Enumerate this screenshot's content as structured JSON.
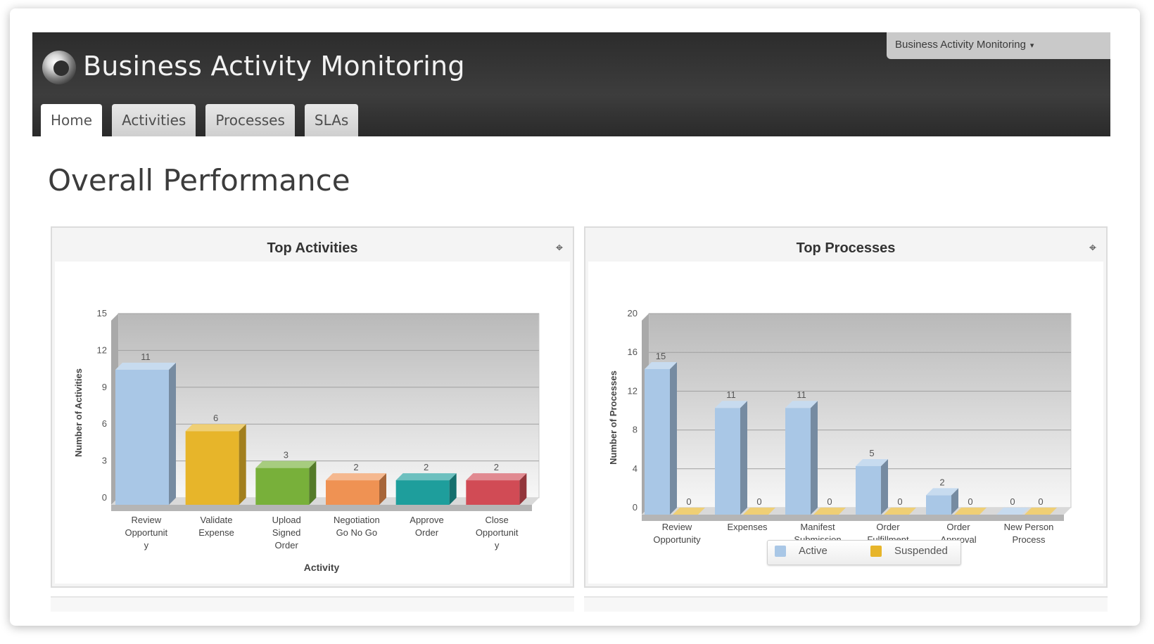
{
  "app": {
    "title": "Business Activity Monitoring",
    "menu_label": "Business Activity Monitoring",
    "menu_caret": "▾",
    "tabs": [
      {
        "label": "Home",
        "active": true
      },
      {
        "label": "Activities",
        "active": false
      },
      {
        "label": "Processes",
        "active": false
      },
      {
        "label": "SLAs",
        "active": false
      }
    ]
  },
  "page": {
    "title": "Overall Performance"
  },
  "panels": {
    "left": {
      "title": "Top Activities",
      "zoom_icon": "zoom-icon"
    },
    "right": {
      "title": "Top Processes",
      "zoom_icon": "zoom-icon"
    }
  },
  "legend": {
    "active": "Active",
    "suspended": "Suspended"
  },
  "colors": {
    "header_bg": "#333333",
    "blue": "#a9c7e6",
    "yellow": "#e7b52a",
    "green": "#78b03a",
    "orange": "#ef9253",
    "teal": "#1e9e9c",
    "red": "#d14b55"
  },
  "chart_data": [
    {
      "type": "bar",
      "title": "Top Activities",
      "xlabel": "Activity",
      "ylabel": "Number of Activities",
      "ylim": [
        0,
        15
      ],
      "yticks": [
        0,
        3,
        6,
        9,
        12,
        15
      ],
      "categories": [
        [
          "Review",
          "Opportunit",
          "y"
        ],
        [
          "Validate",
          "Expense"
        ],
        [
          "Upload",
          "Signed",
          "Order"
        ],
        [
          "Negotiation",
          "Go No Go"
        ],
        [
          "Approve",
          "Order"
        ],
        [
          "Close",
          "Opportunit",
          "y"
        ]
      ],
      "values": [
        11,
        6,
        3,
        2,
        2,
        2
      ],
      "bar_colors": [
        "#a9c7e6",
        "#e7b52a",
        "#78b03a",
        "#ef9253",
        "#1e9e9c",
        "#d14b55"
      ],
      "grid": true,
      "style": "3d"
    },
    {
      "type": "bar",
      "title": "Top Processes",
      "xlabel": "",
      "ylabel": "Number of Processes",
      "ylim": [
        0,
        20
      ],
      "yticks": [
        0,
        4,
        8,
        12,
        16,
        20
      ],
      "categories": [
        [
          "Review",
          "Opportunity"
        ],
        [
          "Expenses"
        ],
        [
          "Manifest",
          "Submission"
        ],
        [
          "Order",
          "Fulfillment"
        ],
        [
          "Order",
          "Approval"
        ],
        [
          "New Person",
          "Process"
        ]
      ],
      "series": [
        {
          "name": "Active",
          "values": [
            15,
            11,
            11,
            5,
            2,
            0
          ],
          "color": "#a9c7e6"
        },
        {
          "name": "Suspended",
          "values": [
            0,
            0,
            0,
            0,
            0,
            0
          ],
          "color": "#e7b52a"
        }
      ],
      "legend": "bottom",
      "grid": true,
      "style": "3d"
    }
  ]
}
